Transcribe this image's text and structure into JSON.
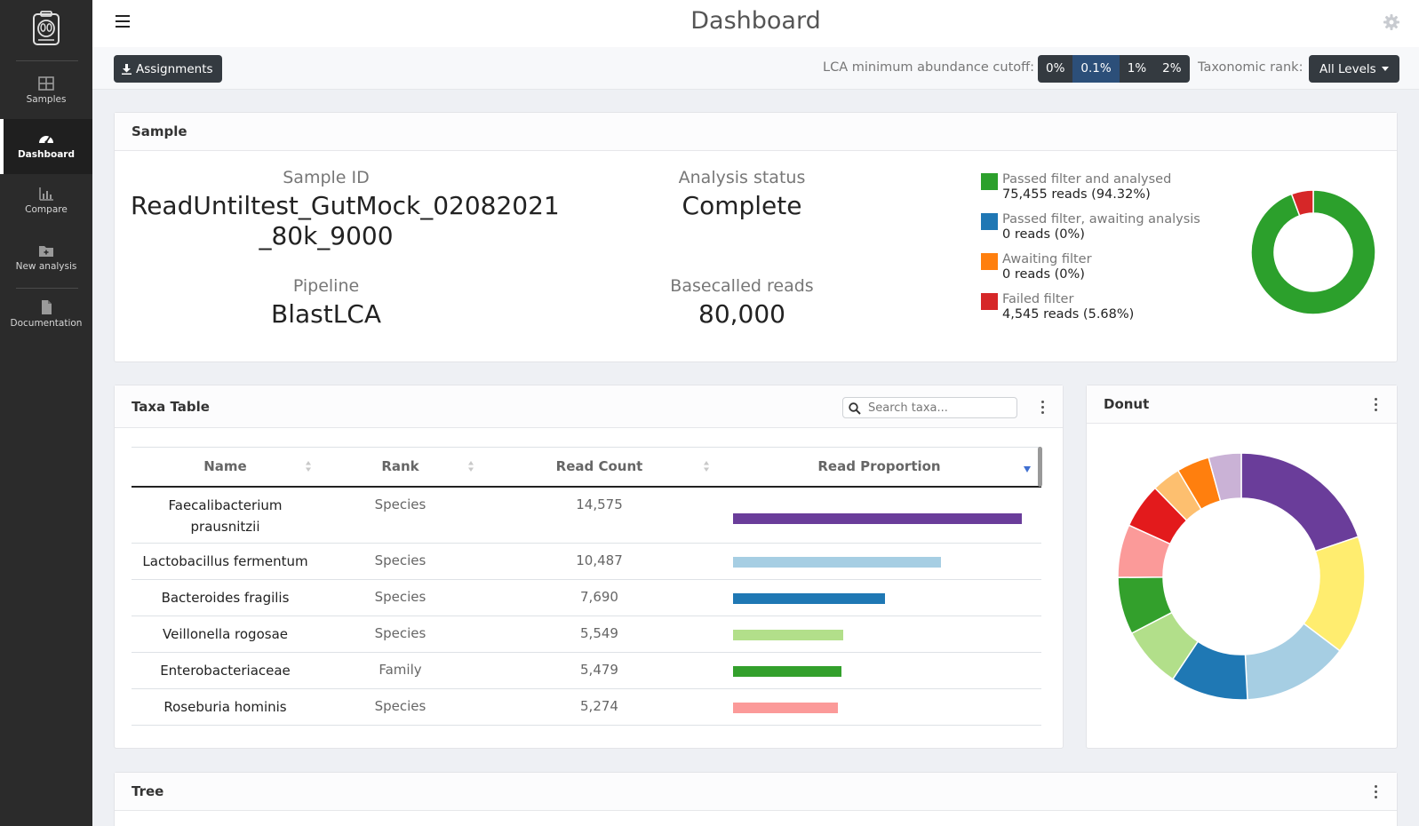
{
  "sidebar": {
    "items": [
      {
        "label": "Samples",
        "icon": "table-icon"
      },
      {
        "label": "Dashboard",
        "icon": "gauge-icon"
      },
      {
        "label": "Compare",
        "icon": "bar-chart-icon"
      },
      {
        "label": "New analysis",
        "icon": "folder-plus-icon"
      },
      {
        "label": "Documentation",
        "icon": "file-icon"
      }
    ]
  },
  "header": {
    "title": "Dashboard"
  },
  "toolbar": {
    "assignments_label": "Assignments",
    "cutoff_label": "LCA minimum abundance cutoff:",
    "cutoff_options": [
      "0%",
      "0.1%",
      "1%",
      "2%"
    ],
    "cutoff_selected": "0.1%",
    "rank_label": "Taxonomic rank:",
    "rank_value": "All Levels"
  },
  "sample": {
    "title": "Sample",
    "sample_id_label": "Sample ID",
    "sample_id_line1": "ReadUntiltest_GutMock_02082021",
    "sample_id_line2": "_80k_9000",
    "status_label": "Analysis status",
    "status_value": "Complete",
    "pipeline_label": "Pipeline",
    "pipeline_value": "BlastLCA",
    "reads_label": "Basecalled reads",
    "reads_value": "80,000",
    "legend": [
      {
        "label": "Passed filter and analysed",
        "value": "75,455 reads (94.32%)",
        "color": "#2ca02c"
      },
      {
        "label": "Passed filter, awaiting analysis",
        "value": "0 reads (0%)",
        "color": "#1f77b4"
      },
      {
        "label": "Awaiting filter",
        "value": "0 reads (0%)",
        "color": "#ff7f0e"
      },
      {
        "label": "Failed filter",
        "value": "4,545 reads (5.68%)",
        "color": "#d62728"
      }
    ],
    "status_donut": [
      {
        "value": 94.32,
        "color": "#2ca02c"
      },
      {
        "value": 5.68,
        "color": "#d62728"
      }
    ]
  },
  "taxa": {
    "title": "Taxa Table",
    "search_placeholder": "Search taxa...",
    "columns": [
      "Name",
      "Rank",
      "Read Count",
      "Read Proportion"
    ],
    "rows": [
      {
        "name": "Faecalibacterium prausnitzii",
        "rank": "Species",
        "count": "14,575",
        "reads": 14575,
        "color": "#6a3d9a"
      },
      {
        "name": "Lactobacillus fermentum",
        "rank": "Species",
        "count": "10,487",
        "reads": 10487,
        "color": "#a6cee3"
      },
      {
        "name": "Bacteroides fragilis",
        "rank": "Species",
        "count": "7,690",
        "reads": 7690,
        "color": "#1f78b4"
      },
      {
        "name": "Veillonella rogosae",
        "rank": "Species",
        "count": "5,549",
        "reads": 5549,
        "color": "#b2df8a"
      },
      {
        "name": "Enterobacteriaceae",
        "rank": "Family",
        "count": "5,479",
        "reads": 5479,
        "color": "#33a02c"
      },
      {
        "name": "Roseburia hominis",
        "rank": "Species",
        "count": "5,274",
        "reads": 5274,
        "color": "#fb9a99"
      }
    ]
  },
  "donut": {
    "title": "Donut"
  },
  "chart_data": {
    "type": "pie",
    "title": "",
    "series": [
      {
        "value": 18.5,
        "color": "#6a3d9a"
      },
      {
        "value": 14.5,
        "color": "#ffed6f"
      },
      {
        "value": 13.0,
        "color": "#a6cee3"
      },
      {
        "value": 9.5,
        "color": "#1f78b4"
      },
      {
        "value": 7.5,
        "color": "#b2df8a"
      },
      {
        "value": 7.0,
        "color": "#33a02c"
      },
      {
        "value": 6.5,
        "color": "#fb9a99"
      },
      {
        "value": 5.5,
        "color": "#e31a1c"
      },
      {
        "value": 3.5,
        "color": "#fdbf6f"
      },
      {
        "value": 4.0,
        "color": "#ff7f0e"
      },
      {
        "value": 4.0,
        "color": "#cab2d6"
      }
    ]
  },
  "tree": {
    "title": "Tree"
  }
}
